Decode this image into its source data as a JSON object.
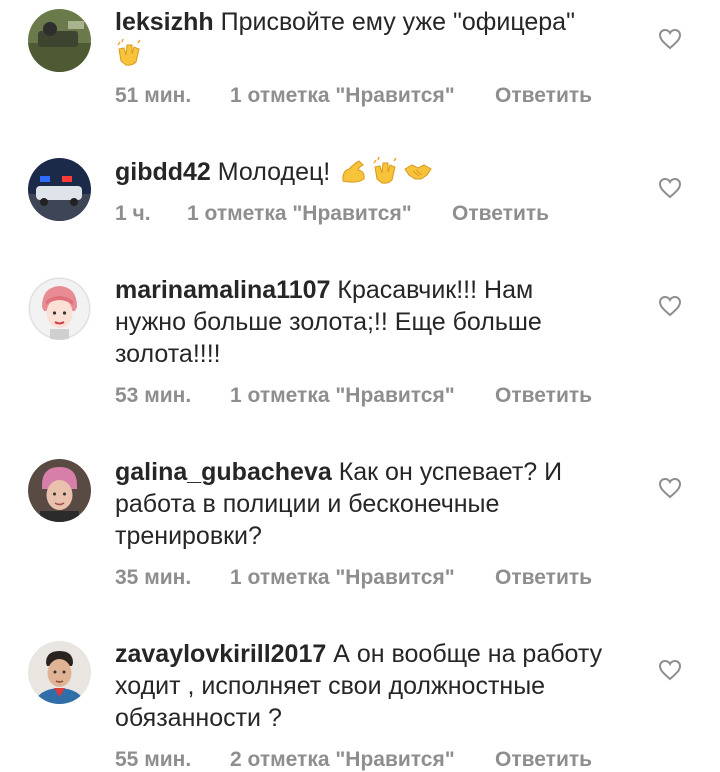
{
  "comments": [
    {
      "username": "leksizhh",
      "text": "Присвойте ему уже \"офицера\"",
      "emojis": [
        "clapping-hands"
      ],
      "time": "51 мин.",
      "likes": "1 отметка \"Нравится\"",
      "reply": "Ответить"
    },
    {
      "username": "gibdd42",
      "text": "Молодец!",
      "emojis": [
        "flexed-biceps",
        "clapping-hands",
        "handshake"
      ],
      "time": "1 ч.",
      "likes": "1 отметка \"Нравится\"",
      "reply": "Ответить"
    },
    {
      "username": "marinamalina1107",
      "text": "Красавчик!!! Нам нужно больше золота;!! Еще больше золота!!!!",
      "emojis": [],
      "time": "53 мин.",
      "likes": "1 отметка \"Нравится\"",
      "reply": "Ответить"
    },
    {
      "username": "galina_gubacheva",
      "text": "Как он успевает? И работа в полиции и бесконечные тренировки?",
      "emojis": [],
      "time": "35 мин.",
      "likes": "1 отметка \"Нравится\"",
      "reply": "Ответить"
    },
    {
      "username": "zavaylovkirill2017",
      "text": "А он вообще на работу ходит , исполняет свои должностные обязанности ?",
      "emojis": [],
      "time": "55 мин.",
      "likes": "2 отметка \"Нравится\"",
      "reply": "Ответить"
    }
  ],
  "colors": {
    "text": "#262626",
    "meta": "#8e8e8e",
    "heart_outline": "#8e8e8e"
  }
}
